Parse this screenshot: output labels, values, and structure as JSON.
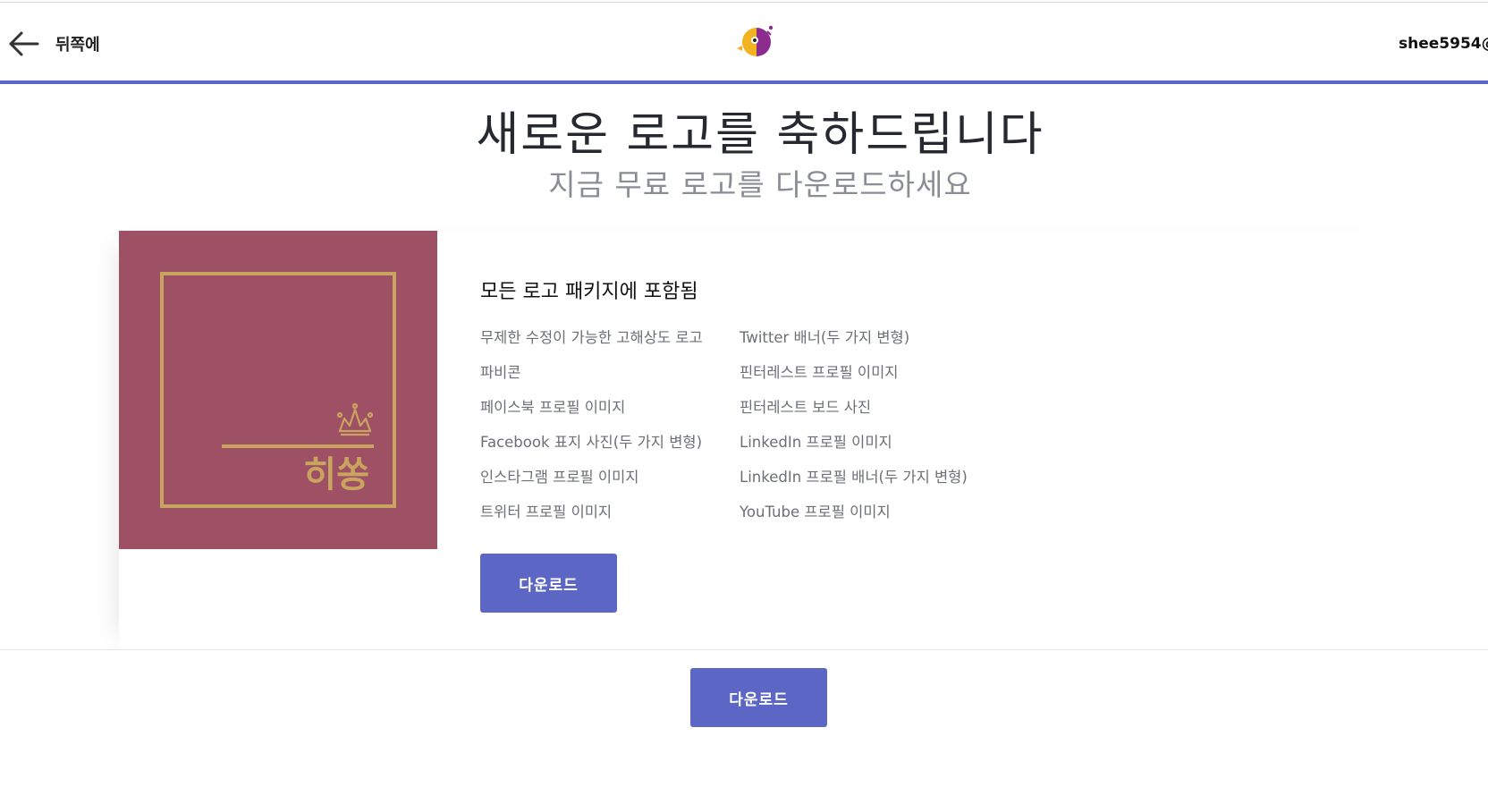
{
  "header": {
    "back_label": "뒤쪽에",
    "user_label": "shee5954@",
    "accent_color": "#5c66c4"
  },
  "hero": {
    "title": "새로운 로고를 축하드립니다",
    "subtitle": "지금 무료 로고를 다운로드하세요"
  },
  "logo_preview": {
    "text": "히쏭",
    "background": "#9e5064",
    "accent": "#c8a45f"
  },
  "package": {
    "title": "모든 로고 패키지에 포함됨",
    "left_items": [
      "무제한 수정이 가능한 고해상도 로고",
      "파비콘",
      "페이스북 프로필 이미지",
      "Facebook 표지 사진(두 가지 변형)",
      "인스타그램 프로필 이미지",
      "트위터 프로필 이미지"
    ],
    "right_items": [
      "Twitter 배너(두 가지 변형)",
      "핀터레스트 프로필 이미지",
      "핀터레스트 보드 사진",
      "LinkedIn 프로필 이미지",
      "LinkedIn 프로필 배너(두 가지 변형)",
      "YouTube 프로필 이미지"
    ],
    "download_label": "다운로드"
  },
  "footer": {
    "download_label": "다운로드"
  },
  "icons": {
    "back": "arrow-left-icon",
    "brand": "brand-logo-icon",
    "crown": "crown-icon"
  }
}
